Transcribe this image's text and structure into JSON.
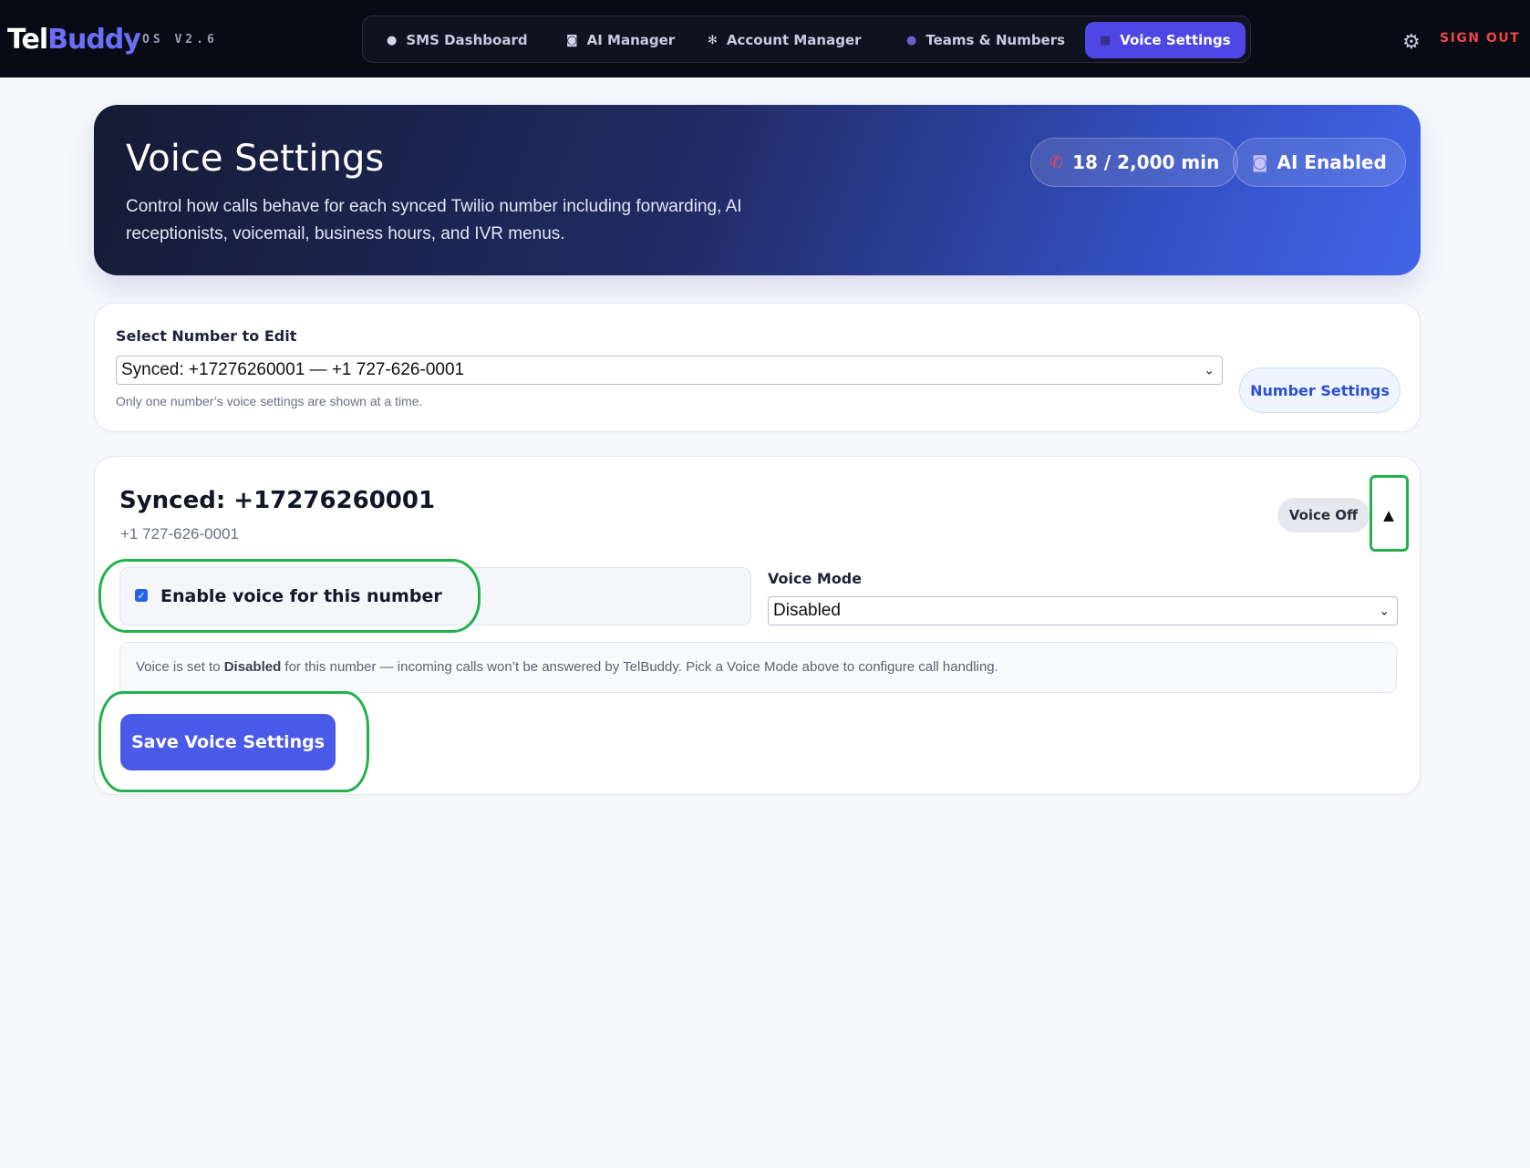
{
  "brand": {
    "tel": "Tel",
    "buddy": "Buddy",
    "version": "OS V2.6"
  },
  "nav": {
    "items": [
      {
        "label": "SMS Dashboard",
        "icon": "chat-bubble-icon"
      },
      {
        "label": "AI Manager",
        "icon": "robot-icon"
      },
      {
        "label": "Account Manager",
        "icon": "gear-icon"
      },
      {
        "label": "Teams & Numbers",
        "icon": "people-icon"
      },
      {
        "label": "Voice Settings",
        "icon": "voice-icon",
        "active": true
      }
    ],
    "signout": "SIGN OUT"
  },
  "hero": {
    "title": "Voice Settings",
    "subtitle": "Control how calls behave for each synced Twilio number including forwarding, AI receptionists, voicemail, business hours, and IVR menus.",
    "minutes": "18 / 2,000 min",
    "ai_status": "AI Enabled"
  },
  "select": {
    "label": "Select Number to Edit",
    "value": "Synced: +17276260001 — +1 727-626-0001",
    "hint": "Only one number’s voice settings are shown at a time.",
    "button": "Number Settings"
  },
  "number": {
    "title": "Synced: +17276260001",
    "formatted": "+1 727-626-0001",
    "badge": "Voice Off",
    "enable_label": "Enable voice for this number",
    "enable_checked": true,
    "mode_label": "Voice Mode",
    "mode_value": "Disabled",
    "info_prefix": "Voice is set to ",
    "info_mode": "Disabled",
    "info_suffix": " for this number — incoming calls won’t be answered by TelBuddy. Pick a Voice Mode above to configure call handling.",
    "save_button": "Save Voice Settings"
  },
  "colors": {
    "accent": "#4f46e5",
    "primary_button": "#4a5ae8",
    "signout": "#ef4444",
    "annotation": "#22b14c"
  }
}
